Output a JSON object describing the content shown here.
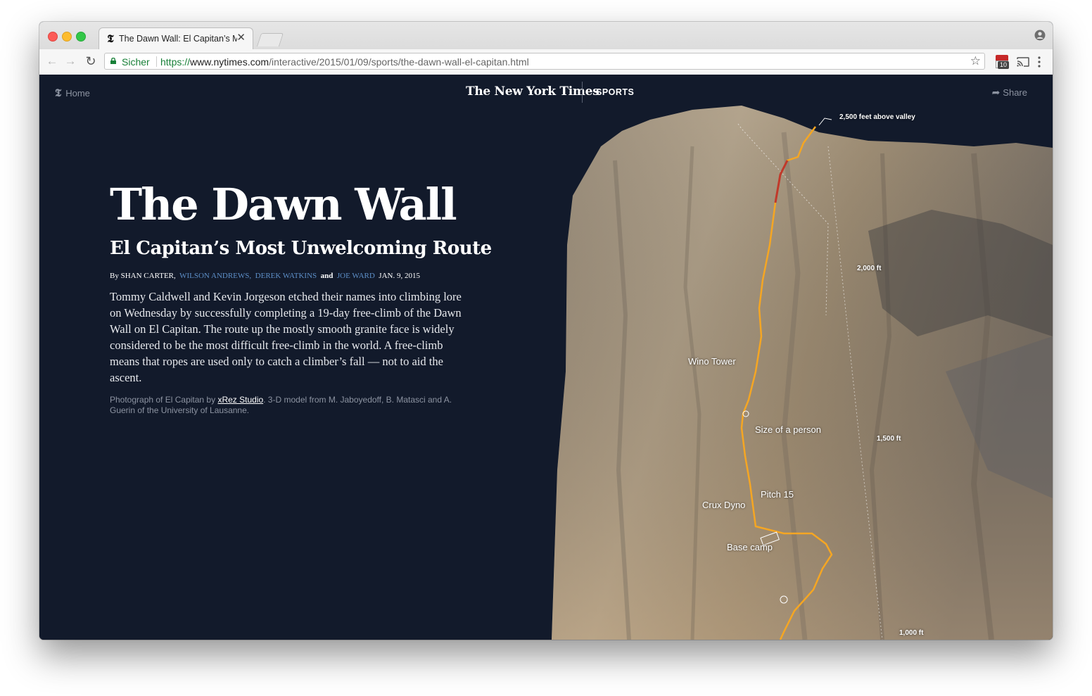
{
  "browser": {
    "tab_title": "The Dawn Wall: El Capitan’s Mo",
    "tab_close": "✕",
    "secure_label": "Sicher",
    "url_scheme": "https://",
    "url_host": "www.nytimes.com",
    "url_path": "/interactive/2015/01/09/sports/the-dawn-wall-el-capitan.html",
    "extension_badge": "10"
  },
  "nav": {
    "home_label": "Home",
    "masthead": "The New York Times",
    "section": "SPORTS",
    "share_label": "Share"
  },
  "article": {
    "headline": "The Dawn Wall",
    "subhead": "El Capitan’s Most Unwelcoming Route",
    "byline": {
      "by": "By SHAN CARTER,",
      "authors": [
        "WILSON ANDREWS,",
        "DEREK WATKINS",
        "JOE WARD"
      ],
      "and": "and",
      "date": "JAN. 9, 2015"
    },
    "lede": "Tommy Caldwell and Kevin Jorgeson etched their names into climbing lore on Wednesday by successfully completing a 19-day free-climb of the Dawn Wall on El Capitan. The route up the mostly smooth granite face is widely considered to be the most difficult free-climb in the world. A free-climb means that ropes are used only to catch a climber’s fall — not to aid the ascent.",
    "credit": {
      "before": "Photograph of El Capitan by ",
      "studio": "xRez Studio",
      "after": ". 3-D model from M. Jaboyedoff, B. Matasci and A. Guerin of the University of Lausanne."
    }
  },
  "rock_labels": {
    "summit": "2,500 feet above valley",
    "ft_2000": "2,000 ft",
    "ft_1500": "1,500 ft",
    "ft_1000": "1,000 ft",
    "wino_tower": "Wino Tower",
    "size_person": "Size of a person",
    "pitch_15": "Pitch 15",
    "crux_dyno": "Crux Dyno",
    "base_camp": "Base camp"
  },
  "colors": {
    "page_bg": "#121a2b",
    "route": "#f5a623",
    "route_dark": "#c0392b",
    "author_link": "#5d8fc8",
    "secure_green": "#188038"
  }
}
